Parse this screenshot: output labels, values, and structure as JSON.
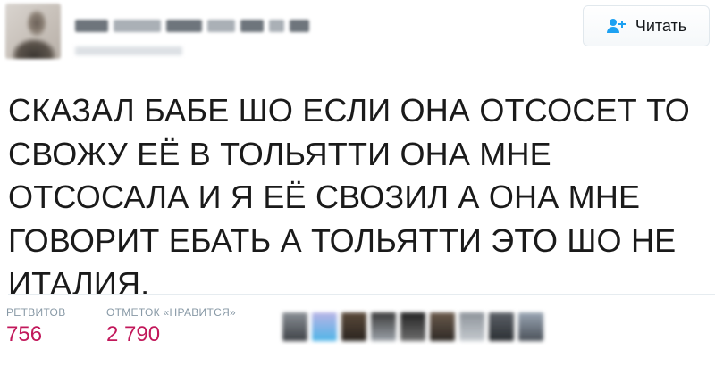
{
  "follow_button": {
    "label": "Читать"
  },
  "tweet": {
    "text": "СКАЗАЛ БАБЕ ШО ЕСЛИ ОНА ОТСОСЕТ ТО СВОЖУ ЕЁ В ТОЛЬЯТТИ ОНА МНЕ ОТСОСАЛА И Я ЕЁ СВОЗИЛ А ОНА МНЕ ГОВОРИТ ЕБАТЬ А ТОЛЬЯТТИ ЭТО ШО НЕ ИТАЛИЯ."
  },
  "stats": {
    "retweets": {
      "label": "РЕТВИТОВ",
      "value": "756"
    },
    "likes": {
      "label": "ОТМЕТОК «НРАВИТСЯ»",
      "value": "2 790"
    }
  },
  "colors": {
    "accent": "#1da1f2",
    "stat_value": "#c2185b",
    "stat_label": "#8899a6"
  },
  "icons": {
    "follow": "add-person-icon"
  }
}
